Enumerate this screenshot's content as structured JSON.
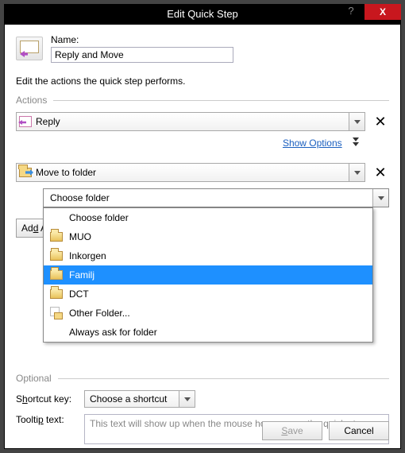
{
  "titlebar": {
    "title": "Edit Quick Step",
    "help": "?",
    "close": "X"
  },
  "name": {
    "label": "Name:",
    "value": "Reply and Move"
  },
  "intro": "Edit the actions the quick step performs.",
  "sections": {
    "actions": "Actions",
    "optional": "Optional"
  },
  "action1": {
    "label": "Reply",
    "show_options": "Show Options"
  },
  "action2": {
    "label": "Move to folder",
    "sub_label": "Choose folder"
  },
  "folder_popup": {
    "items": [
      {
        "label": "Choose folder",
        "icon": "none"
      },
      {
        "label": "MUO",
        "icon": "folder"
      },
      {
        "label": "Inkorgen",
        "icon": "folder"
      },
      {
        "label": "Familj",
        "icon": "folder",
        "selected": true
      },
      {
        "label": "DCT",
        "icon": "folder"
      },
      {
        "label": "Other Folder...",
        "icon": "other"
      },
      {
        "label": "Always ask for folder",
        "icon": "none"
      }
    ]
  },
  "add_action": {
    "prefix": "Ad",
    "underlined": "d",
    "suffix": " Action"
  },
  "optional": {
    "shortcut_label_pre": "S",
    "shortcut_label_ul": "h",
    "shortcut_label_post": "ortcut key:",
    "shortcut_value": "Choose a shortcut",
    "tooltip_label_pre": "Toolti",
    "tooltip_label_ul": "p",
    "tooltip_label_post": " text:",
    "tooltip_placeholder": "This text will show up when the mouse hovers over the quick step."
  },
  "footer": {
    "save_ul": "S",
    "save_post": "ave",
    "cancel": "Cancel"
  }
}
